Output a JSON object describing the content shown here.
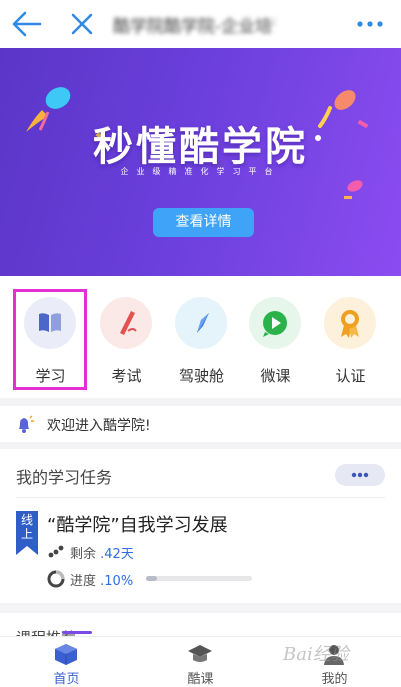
{
  "topbar": {
    "title": "酷学院酷学院-企业培训平台"
  },
  "banner": {
    "title": "秒懂酷学院",
    "subtitle": "企业级精准化学习平台",
    "button": "查看详情"
  },
  "quick": [
    {
      "label": "学习",
      "icon": "book-icon",
      "color": "#7b8fd8",
      "bg": "#eaedf7"
    },
    {
      "label": "考试",
      "icon": "pen-icon",
      "color": "#e2534f",
      "bg": "#fbe9e8"
    },
    {
      "label": "驾驶舱",
      "icon": "compass-icon",
      "color": "#3b7be6",
      "bg": "#e5f3fb"
    },
    {
      "label": "微课",
      "icon": "play-icon",
      "color": "#2bb24a",
      "bg": "#e6f6ea"
    },
    {
      "label": "认证",
      "icon": "medal-icon",
      "color": "#f0a020",
      "bg": "#fdf1dc"
    }
  ],
  "notice": {
    "text": "欢迎进入酷学院!"
  },
  "task": {
    "section_title": "我的学习任务",
    "tag": "线上",
    "course": "“酷学院”自我学习发展",
    "remaining_label": "剩余",
    "remaining_value": ".42天",
    "progress_label": "进度",
    "progress_value": ".10%",
    "progress_fraction": 0.1
  },
  "next_section": {
    "title": "课程推荐"
  },
  "bottomnav": [
    {
      "label": "首页",
      "icon": "home-cube-icon",
      "active": true
    },
    {
      "label": "酷课",
      "icon": "graduation-cap-icon",
      "active": false
    },
    {
      "label": "我的",
      "icon": "person-icon",
      "active": false
    }
  ],
  "watermark": "Bai经验"
}
